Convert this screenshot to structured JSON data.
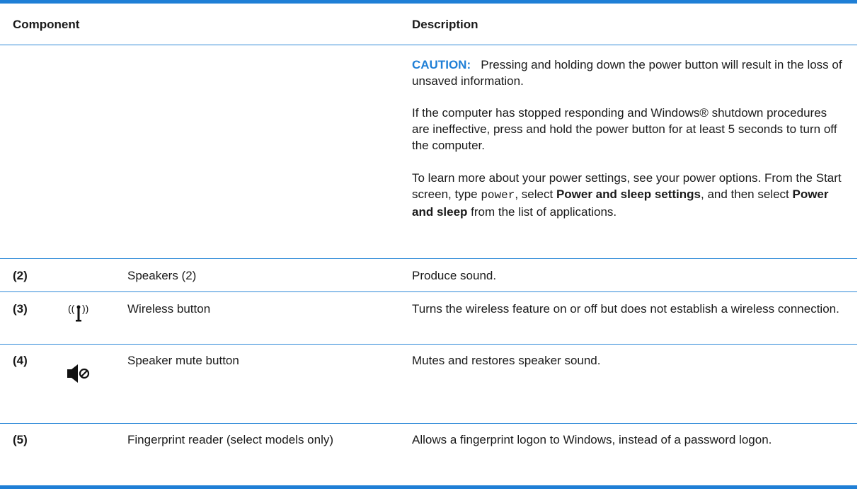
{
  "headers": {
    "component": "Component",
    "description": "Description"
  },
  "power_row": {
    "caution_label": "CAUTION:",
    "caution_text": "Pressing and holding down the power button will result in the loss of unsaved information.",
    "shutdown_text": "If the computer has stopped responding and Windows® shutdown procedures are ineffective, press and hold the power button for at least 5 seconds to turn off the computer.",
    "settings_text_1": "To learn more about your power settings, see your power options. From the Start screen, type ",
    "settings_code": "power",
    "settings_text_2": ", select ",
    "settings_bold_1": "Power and sleep settings",
    "settings_text_3": ", and then select ",
    "settings_bold_2": "Power and sleep",
    "settings_text_4": " from the list of applications."
  },
  "rows": [
    {
      "number": "(2)",
      "icon": "",
      "component": "Speakers (2)",
      "description": "Produce sound."
    },
    {
      "number": "(3)",
      "icon": "wireless-icon",
      "component": "Wireless button",
      "description": "Turns the wireless feature on or off but does not establish a wireless connection."
    },
    {
      "number": "(4)",
      "icon": "speaker-mute-icon",
      "component": "Speaker mute button",
      "description": "Mutes and restores speaker sound."
    },
    {
      "number": "(5)",
      "icon": "",
      "component": "Fingerprint reader (select models only)",
      "description": "Allows a fingerprint logon to Windows, instead of a password logon."
    }
  ],
  "colors": {
    "rule": "#1f7fd6",
    "caution": "#1f7fd6"
  }
}
